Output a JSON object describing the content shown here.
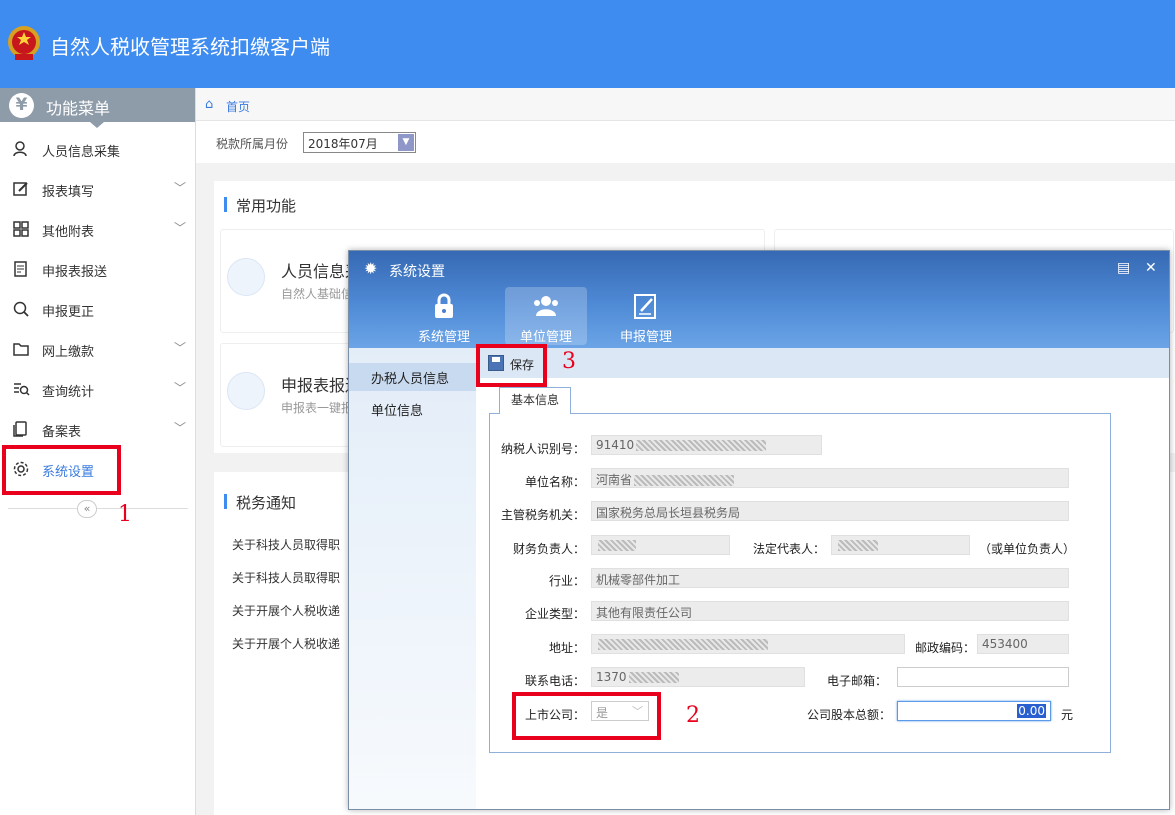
{
  "app": {
    "title": "自然人税收管理系统扣缴客户端"
  },
  "sidebar": {
    "header": "功能菜单",
    "items": [
      {
        "label": "人员信息采集",
        "icon": "person-icon",
        "chevron": false
      },
      {
        "label": "报表填写",
        "icon": "edit-icon",
        "chevron": true
      },
      {
        "label": "其他附表",
        "icon": "grid-icon",
        "chevron": true
      },
      {
        "label": "申报表报送",
        "icon": "document-send-icon",
        "chevron": false
      },
      {
        "label": "申报更正",
        "icon": "search-icon",
        "chevron": false
      },
      {
        "label": "网上缴款",
        "icon": "folder-icon",
        "chevron": true
      },
      {
        "label": "查询统计",
        "icon": "query-icon",
        "chevron": true
      },
      {
        "label": "备案表",
        "icon": "copy-icon",
        "chevron": true
      },
      {
        "label": "系统设置",
        "icon": "gear-icon",
        "chevron": false
      }
    ],
    "collapse": "«"
  },
  "breadcrumb": {
    "home": "首页"
  },
  "filter": {
    "label": "税款所属月份",
    "value": "2018年07月"
  },
  "common": {
    "title": "常用功能",
    "cards": [
      {
        "title": "人员信息采",
        "sub": "自然人基础信"
      },
      {
        "title": "申报表报送",
        "sub": "申报表一键报"
      }
    ]
  },
  "notice": {
    "title": "税务通知",
    "items": [
      "关于科技人员取得职",
      "关于科技人员取得职",
      "关于开展个人税收递",
      "关于开展个人税收递"
    ]
  },
  "dialog": {
    "title": "系统设置",
    "tabs": [
      "系统管理",
      "单位管理",
      "申报管理"
    ],
    "nav": [
      "办税人员信息",
      "单位信息"
    ],
    "save": "保存",
    "form_tab": "基本信息",
    "fields": {
      "taxid_label": "纳税人识别号：",
      "taxid": "91410",
      "name_label": "单位名称：",
      "name": "河南省",
      "authority_label": "主管税务机关：",
      "authority": "国家税务总局长垣县税务局",
      "finance_label": "财务负责人：",
      "legal_label": "法定代表人：",
      "legal_note": "（或单位负责人）",
      "industry_label": "行业：",
      "industry": "机械零部件加工",
      "type_label": "企业类型：",
      "type": "其他有限责任公司",
      "address_label": "地址：",
      "postcode_label": "邮政编码：",
      "postcode": "453400",
      "phone_label": "联系电话：",
      "phone": "1370",
      "email_label": "电子邮箱：",
      "email": "",
      "listed_label": "上市公司：",
      "listed": "是",
      "capital_label": "公司股本总额：",
      "capital": "0.00",
      "capital_unit": "元"
    }
  },
  "annotations": [
    "1",
    "2",
    "3"
  ]
}
